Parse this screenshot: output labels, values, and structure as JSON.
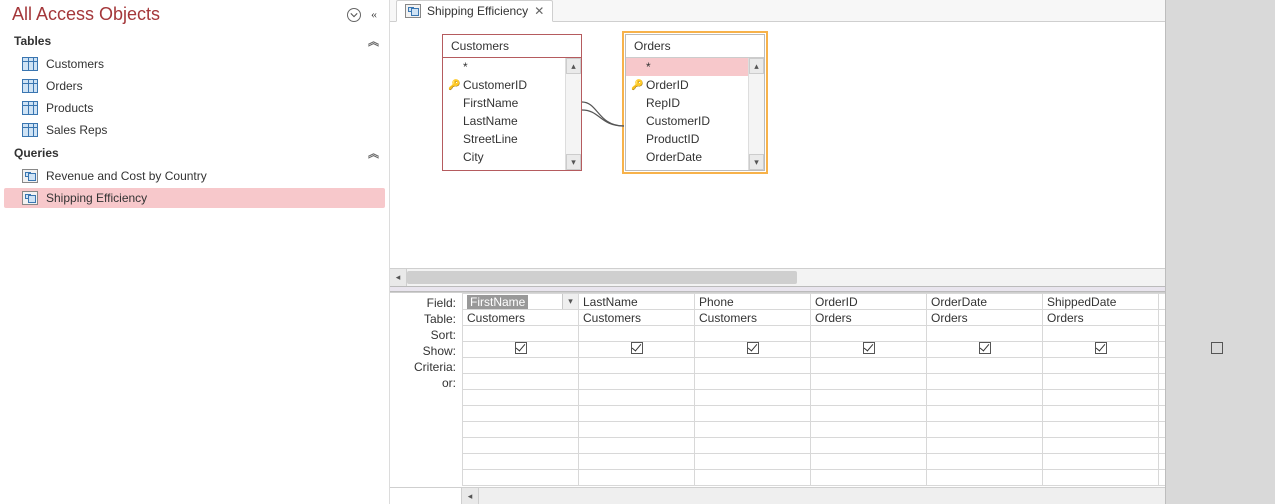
{
  "nav": {
    "title": "All Access Objects",
    "groups": [
      {
        "label": "Tables",
        "items": [
          "Customers",
          "Orders",
          "Products",
          "Sales Reps"
        ]
      },
      {
        "label": "Queries",
        "items": [
          "Revenue and Cost by Country",
          "Shipping Efficiency"
        ]
      }
    ],
    "selected": "Shipping Efficiency"
  },
  "tab": {
    "label": "Shipping Efficiency"
  },
  "diagram": {
    "customers": {
      "title": "Customers",
      "fields": [
        "*",
        "CustomerID",
        "FirstName",
        "LastName",
        "StreetLine",
        "City"
      ],
      "key": "CustomerID"
    },
    "orders": {
      "title": "Orders",
      "fields": [
        "*",
        "OrderID",
        "RepID",
        "CustomerID",
        "ProductID",
        "OrderDate"
      ],
      "key": "OrderID",
      "selected": "*"
    }
  },
  "qbe": {
    "labels": {
      "field": "Field:",
      "table": "Table:",
      "sort": "Sort:",
      "show": "Show:",
      "criteria": "Criteria:",
      "or": "or:"
    },
    "columns": [
      {
        "field": "FirstName",
        "table": "Customers",
        "show": true,
        "active": true
      },
      {
        "field": "LastName",
        "table": "Customers",
        "show": true
      },
      {
        "field": "Phone",
        "table": "Customers",
        "show": true
      },
      {
        "field": "OrderID",
        "table": "Orders",
        "show": true
      },
      {
        "field": "OrderDate",
        "table": "Orders",
        "show": true
      },
      {
        "field": "ShippedDate",
        "table": "Orders",
        "show": true
      },
      {
        "field": "",
        "table": "",
        "show": false
      }
    ]
  }
}
